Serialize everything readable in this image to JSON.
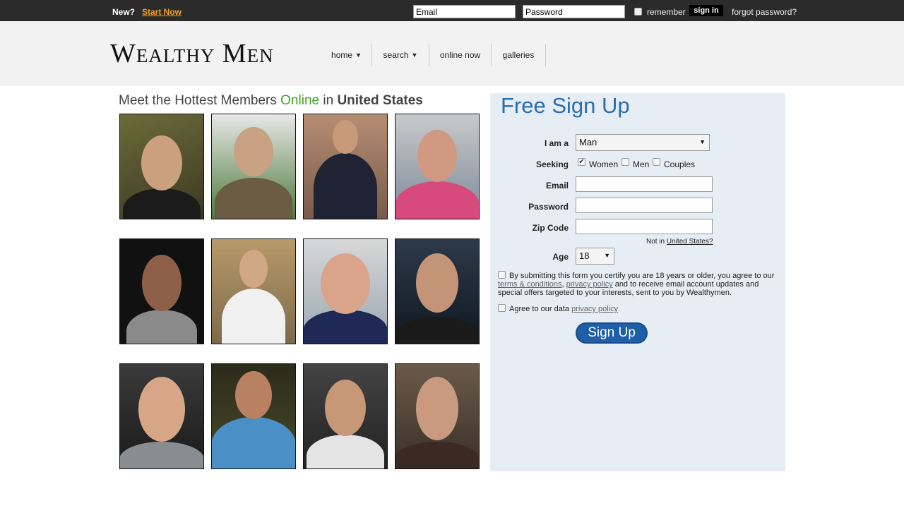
{
  "topbar": {
    "new_label": "New?",
    "start_link": "Start Now",
    "email_placeholder": "Email",
    "password_placeholder": "Password",
    "remember_label": "remember",
    "signin_button": "sign in",
    "forgot_link": "forgot password?"
  },
  "header": {
    "logo": "Wealthy Men",
    "nav": [
      {
        "label": "home",
        "has_arrow": true
      },
      {
        "label": "search",
        "has_arrow": true
      },
      {
        "label": "online now",
        "has_arrow": false
      },
      {
        "label": "galleries",
        "has_arrow": false
      }
    ],
    "arrow_glyph": "▼"
  },
  "members": {
    "title_prefix": "Meet the Hottest Members ",
    "title_online": "Online",
    "title_in": " in ",
    "title_country": "United States"
  },
  "signup": {
    "title": "Free Sign Up",
    "i_am_label": "I am a",
    "i_am_value": "Man",
    "seeking_label": "Seeking",
    "seeking_options": [
      {
        "label": "Women",
        "checked": true
      },
      {
        "label": "Men",
        "checked": false
      },
      {
        "label": "Couples",
        "checked": false
      }
    ],
    "email_label": "Email",
    "password_label": "Password",
    "zip_label": "Zip Code",
    "not_in_prefix": "Not in ",
    "not_in_country": "United States?",
    "age_label": "Age",
    "age_value": "18",
    "legal_1": "By submitting this form you certify you are 18 years or older, you agree to our ",
    "legal_terms": "terms & conditions",
    "legal_comma": ", ",
    "legal_privacy": "privacy policy",
    "legal_2": " and to receive email account updates and special offers targeted to your interests, sent to you by Wealthymen.",
    "agree_text": "Agree to our data ",
    "agree_link": "privacy policy",
    "signup_button": "Sign Up"
  },
  "colors": {
    "accent_orange": "#f0a020",
    "online_green": "#3aa620",
    "signup_blue": "#2a6db0",
    "button_blue": "#1f5fa8"
  }
}
